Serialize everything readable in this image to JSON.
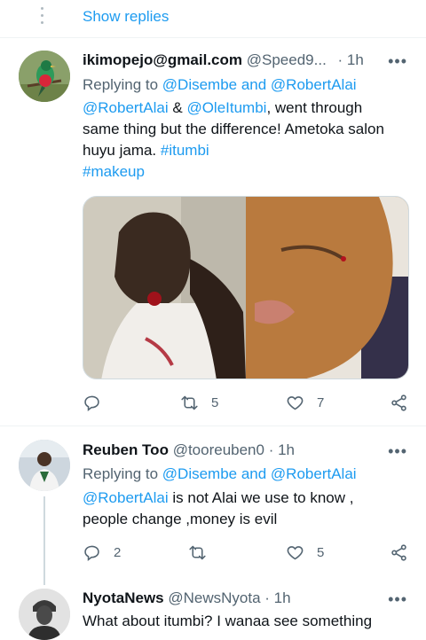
{
  "show_replies": "Show replies",
  "tweets": [
    {
      "name": "ikimopejo@gmail.com",
      "handle": "@Speed9...",
      "time": "· 1h",
      "more": "•••",
      "replying_prefix": "Replying to ",
      "replying_to": "@Disembe and @RobertAlai",
      "mention1": "@RobertAlai",
      "amp": " & ",
      "mention2": "@OleItumbi",
      "text1": ", went through",
      "text2": "same thing but the difference! Ametoka salon",
      "text3": "huyu jama. ",
      "tag1": "#itumbi",
      "tag2": "#makeup",
      "replies": "",
      "retweets": "5",
      "likes": "7"
    },
    {
      "name": "Reuben Too",
      "handle": "@tooreuben0",
      "time": "· 1h",
      "more": "•••",
      "replying_prefix": "Replying to ",
      "replying_to": "@Disembe and @RobertAlai",
      "mention1": "@RobertAlai",
      "text1": " is not Alai we use to know ,",
      "text2": "people change ,money is evil",
      "replies": "2",
      "retweets": "",
      "likes": "5"
    },
    {
      "name": "NyotaNews",
      "handle": "@NewsNyota",
      "time": "· 1h",
      "more": "•••",
      "text1": "What about itumbi? I wanaa see something"
    }
  ],
  "colors": {
    "accent": "#1d9bf0",
    "secondary": "#536471",
    "divider": "#eff3f4"
  }
}
